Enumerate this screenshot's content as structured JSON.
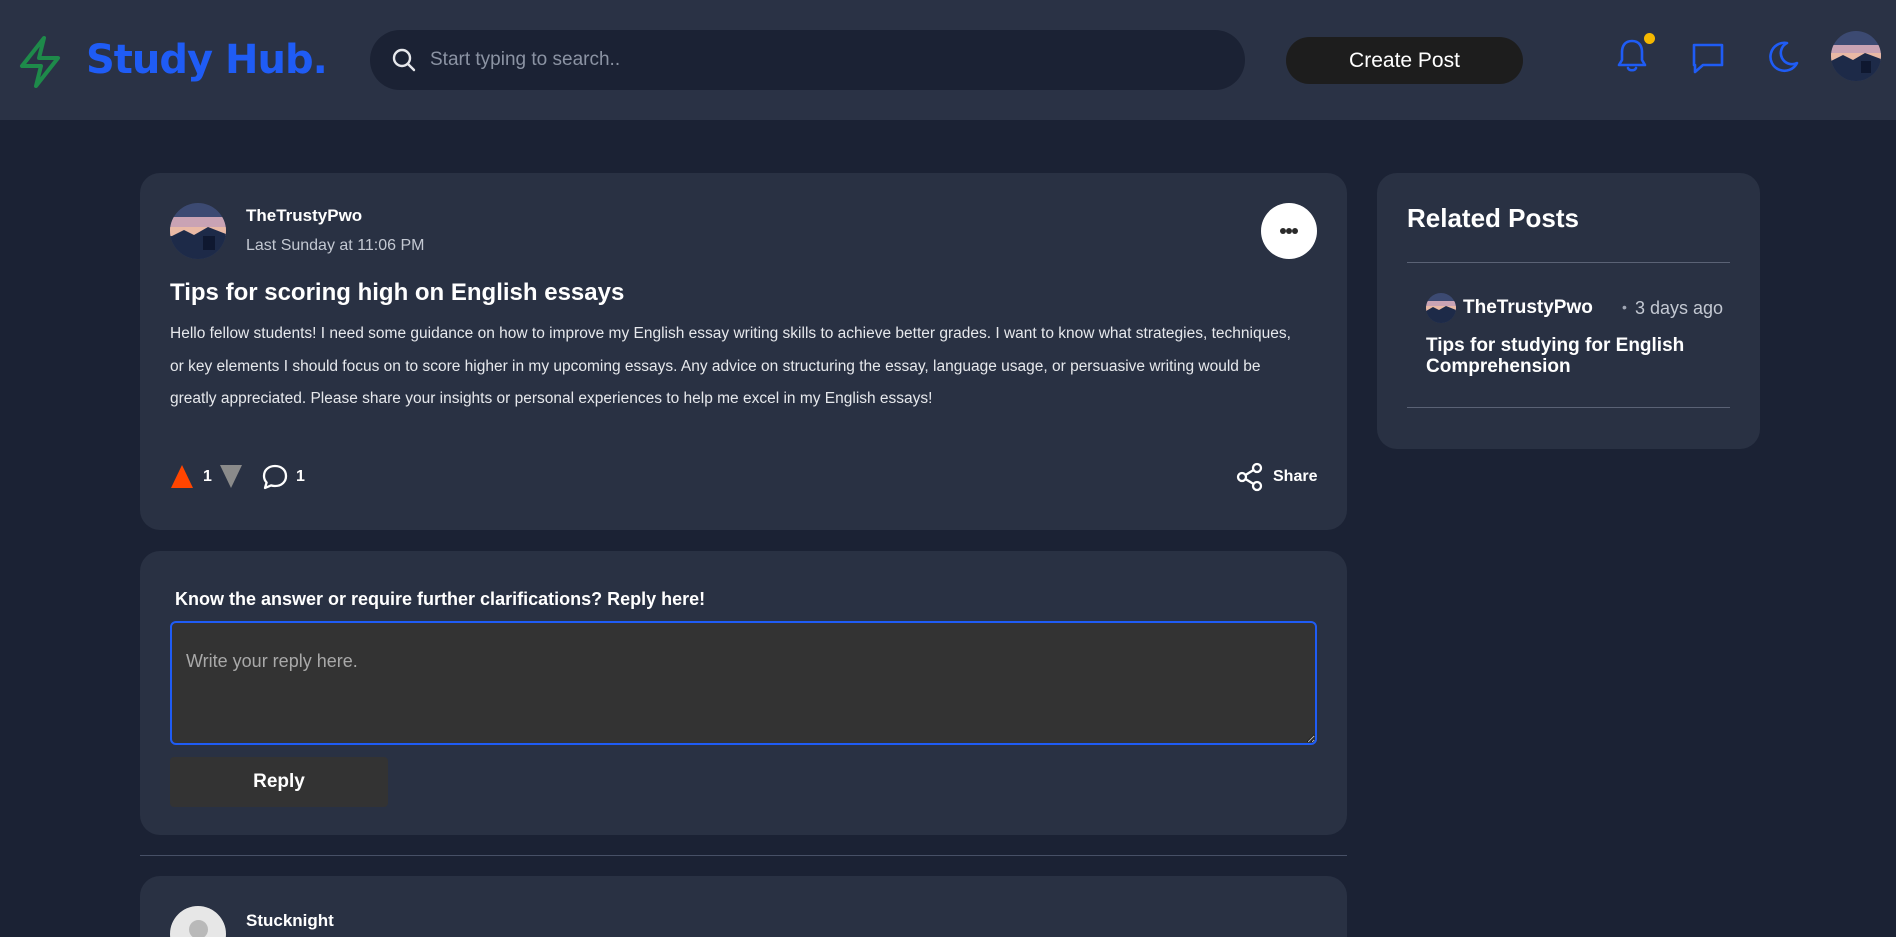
{
  "brand": {
    "name": "Study Hub.",
    "accent_color": "#1f5cf5",
    "logo_icon": "lightning-bolt-icon",
    "logo_icon_color": "#1e8a4a"
  },
  "header": {
    "search": {
      "placeholder": "Start typing to search..",
      "icon": "search-icon"
    },
    "create_post_label": "Create Post",
    "icons": [
      "bell-icon",
      "chat-bubble-icon",
      "moon-icon"
    ],
    "notification_dot_color": "#f5b800"
  },
  "post": {
    "author": "TheTrustyPwo",
    "timestamp": "Last Sunday at 11:06 PM",
    "title": "Tips for scoring high on English essays",
    "body": "Hello fellow students! I need some guidance on how to improve my English essay writing skills to achieve better grades. I want to know what strategies, techniques, or key elements I should focus on to score higher in my upcoming essays. Any advice on structuring the essay, language usage, or persuasive writing would be greatly appreciated. Please share your insights or personal experiences to help me excel in my English essays!",
    "upvotes": "1",
    "comments": "1",
    "share_label": "Share",
    "upvote_color": "#ff4500",
    "downvote_color": "#8a8a8a"
  },
  "reply": {
    "prompt": "Know the answer or require further clarifications? Reply here!",
    "placeholder": "Write your reply here.",
    "button_label": "Reply"
  },
  "comment": {
    "author": "Stucknight"
  },
  "related": {
    "heading": "Related Posts",
    "items": [
      {
        "author": "TheTrustyPwo",
        "separator": "•",
        "time": "3 days ago",
        "title": "Tips for studying for English Comprehension"
      }
    ]
  }
}
